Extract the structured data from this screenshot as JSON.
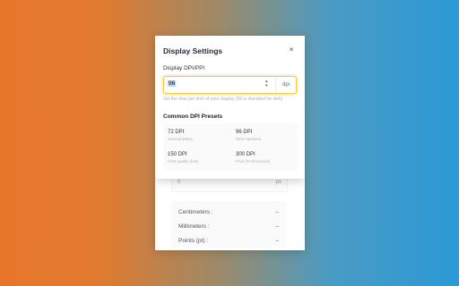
{
  "dialog": {
    "title": "Display Settings",
    "close_glyph": "×",
    "dpi_label": "Display DPI/PPI",
    "dpi_value": "96",
    "spin_up": "▴",
    "spin_down": "▾",
    "unit": "dpi",
    "hint": "Set the dots per inch of your display (96 is standard for web)",
    "presets_title": "Common DPI Presets",
    "presets": [
      {
        "dpi": "72 DPI",
        "desc": "Standard/Mac"
      },
      {
        "dpi": "96 DPI",
        "desc": "Web standard"
      },
      {
        "dpi": "150 DPI",
        "desc": "Print quality (low)"
      },
      {
        "dpi": "300 DPI",
        "desc": "Print (Professional)"
      }
    ]
  },
  "converter": {
    "input_value": "0",
    "input_unit": "px",
    "results": [
      {
        "label": "Centimeters :",
        "value": "–"
      },
      {
        "label": "Millimeters :",
        "value": "–"
      },
      {
        "label": "Points (pt) :",
        "value": "–"
      }
    ]
  },
  "colors": {
    "accent": "#f2c64a",
    "gradient_left": "#e8762a",
    "gradient_right": "#2b9ad6"
  }
}
